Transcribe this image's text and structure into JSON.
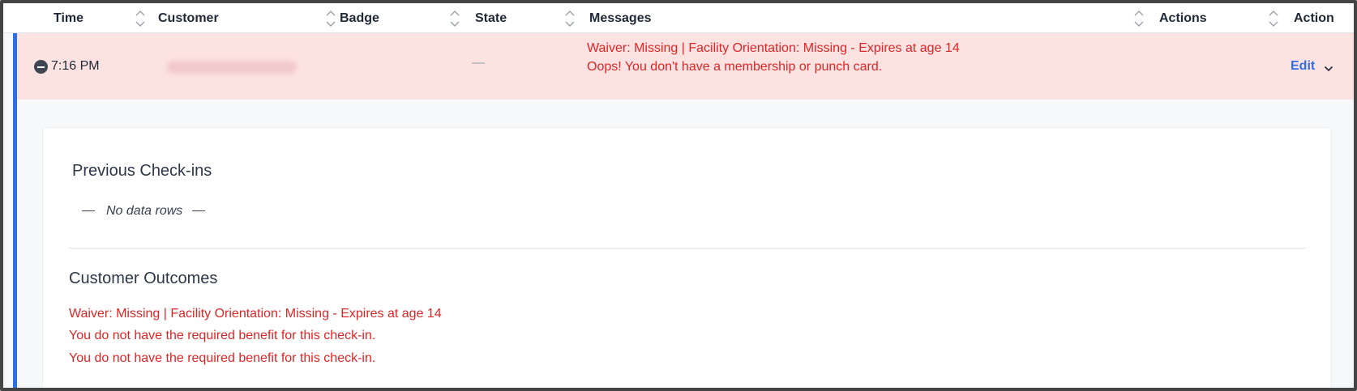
{
  "table": {
    "columns": [
      {
        "label": "Time",
        "sortable": true
      },
      {
        "label": "Customer",
        "sortable": true
      },
      {
        "label": "Badge",
        "sortable": true
      },
      {
        "label": "State",
        "sortable": true
      },
      {
        "label": "Messages",
        "sortable": true
      },
      {
        "label": "Actions",
        "sortable": true
      },
      {
        "label": "Action",
        "sortable": false
      }
    ],
    "row": {
      "time": "7:16 PM",
      "customer": "",
      "state": "—",
      "messages": [
        "Waiver: Missing | Facility Orientation: Missing - Expires at age 14",
        "Oops! You don't have a membership or punch card."
      ],
      "action_label": "Edit"
    }
  },
  "details": {
    "previous_checkins_title": "Previous Check-ins",
    "no_data": "No data rows",
    "customer_outcomes_title": "Customer Outcomes",
    "outcomes": [
      "Waiver: Missing | Facility Orientation: Missing - Expires at age 14",
      "You do not have the required benefit for this check-in.",
      "You do not have the required benefit for this check-in."
    ]
  },
  "colors": {
    "accent": "#2f6fe4",
    "error_text": "#dc2626",
    "row_highlight": "#fde2e2",
    "link": "#2f6fe4"
  },
  "icons": {
    "sort": "sort-arrows-icon",
    "collapse": "minus-circle-icon",
    "dropdown": "chevron-down-icon"
  }
}
